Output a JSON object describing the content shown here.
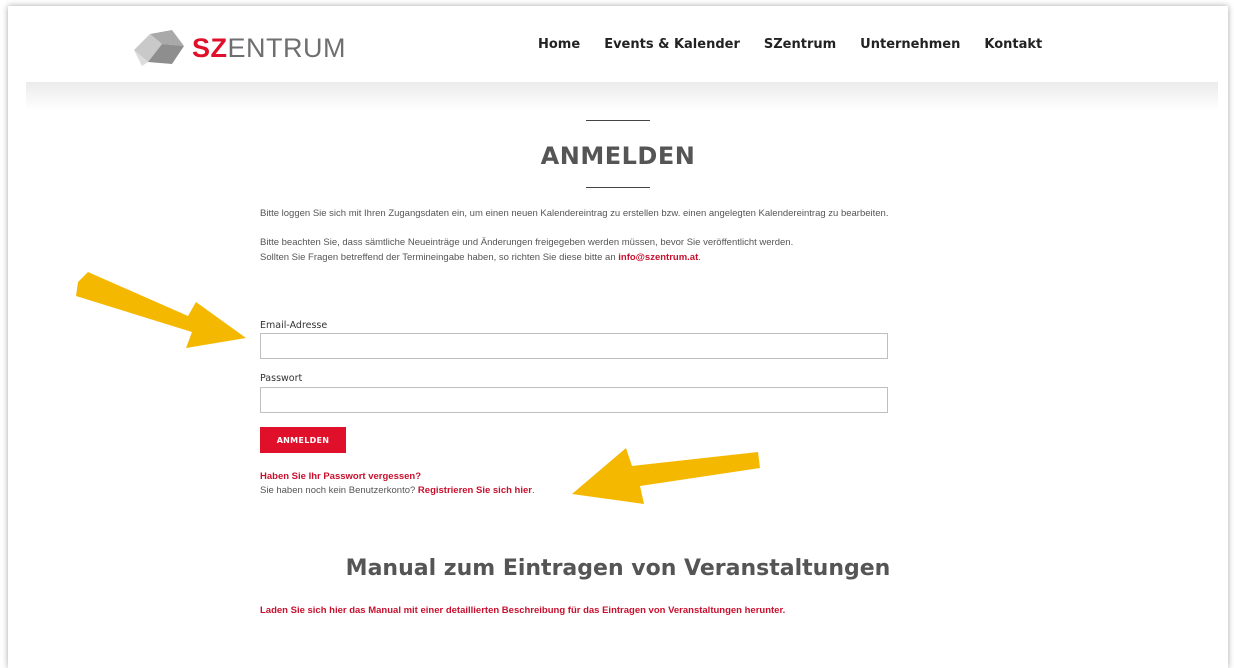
{
  "brand": {
    "logo_prefix": "SZ",
    "logo_suffix": "ENTRUM",
    "accent_color": "#e0102b"
  },
  "nav": {
    "items": [
      {
        "label": "Home"
      },
      {
        "label": "Events & Kalender"
      },
      {
        "label": "SZentrum"
      },
      {
        "label": "Unternehmen"
      },
      {
        "label": "Kontakt"
      }
    ]
  },
  "main": {
    "title": "ANMELDEN",
    "intro_line": "Bitte loggen Sie sich mit Ihren Zugangsdaten ein, um einen neuen Kalendereintrag zu erstellen bzw. einen angelegten Kalendereintrag zu bearbeiten.",
    "notice_line": "Bitte beachten Sie, dass sämtliche Neueinträge und Änderungen freigegeben werden müssen, bevor Sie veröffentlicht werden.",
    "contact_prefix": "Sollten Sie Fragen betreffend der Termineingabe haben, so richten Sie diese bitte an",
    "contact_email": "info@szentrum.at",
    "contact_suffix": "."
  },
  "form": {
    "email_label": "Email-Adresse",
    "email_value": "",
    "password_label": "Passwort",
    "password_value": "",
    "submit_label": "ANMELDEN",
    "forgot_link": "Haben Sie Ihr Passwort vergessen?",
    "register_prefix": "Sie haben noch kein Benutzerkonto?",
    "register_link": "Registrieren Sie sich hier",
    "register_suffix": "."
  },
  "manual": {
    "title": "Manual zum Eintragen von Veranstaltungen",
    "link": "Laden Sie sich hier das Manual mit einer detaillierten Beschreibung für das Eintragen von Veranstaltungen herunter."
  },
  "annotations": {
    "arrow_color": "#f5b800",
    "icons": [
      "logo-icon",
      "arrow-annotation-icon"
    ]
  }
}
